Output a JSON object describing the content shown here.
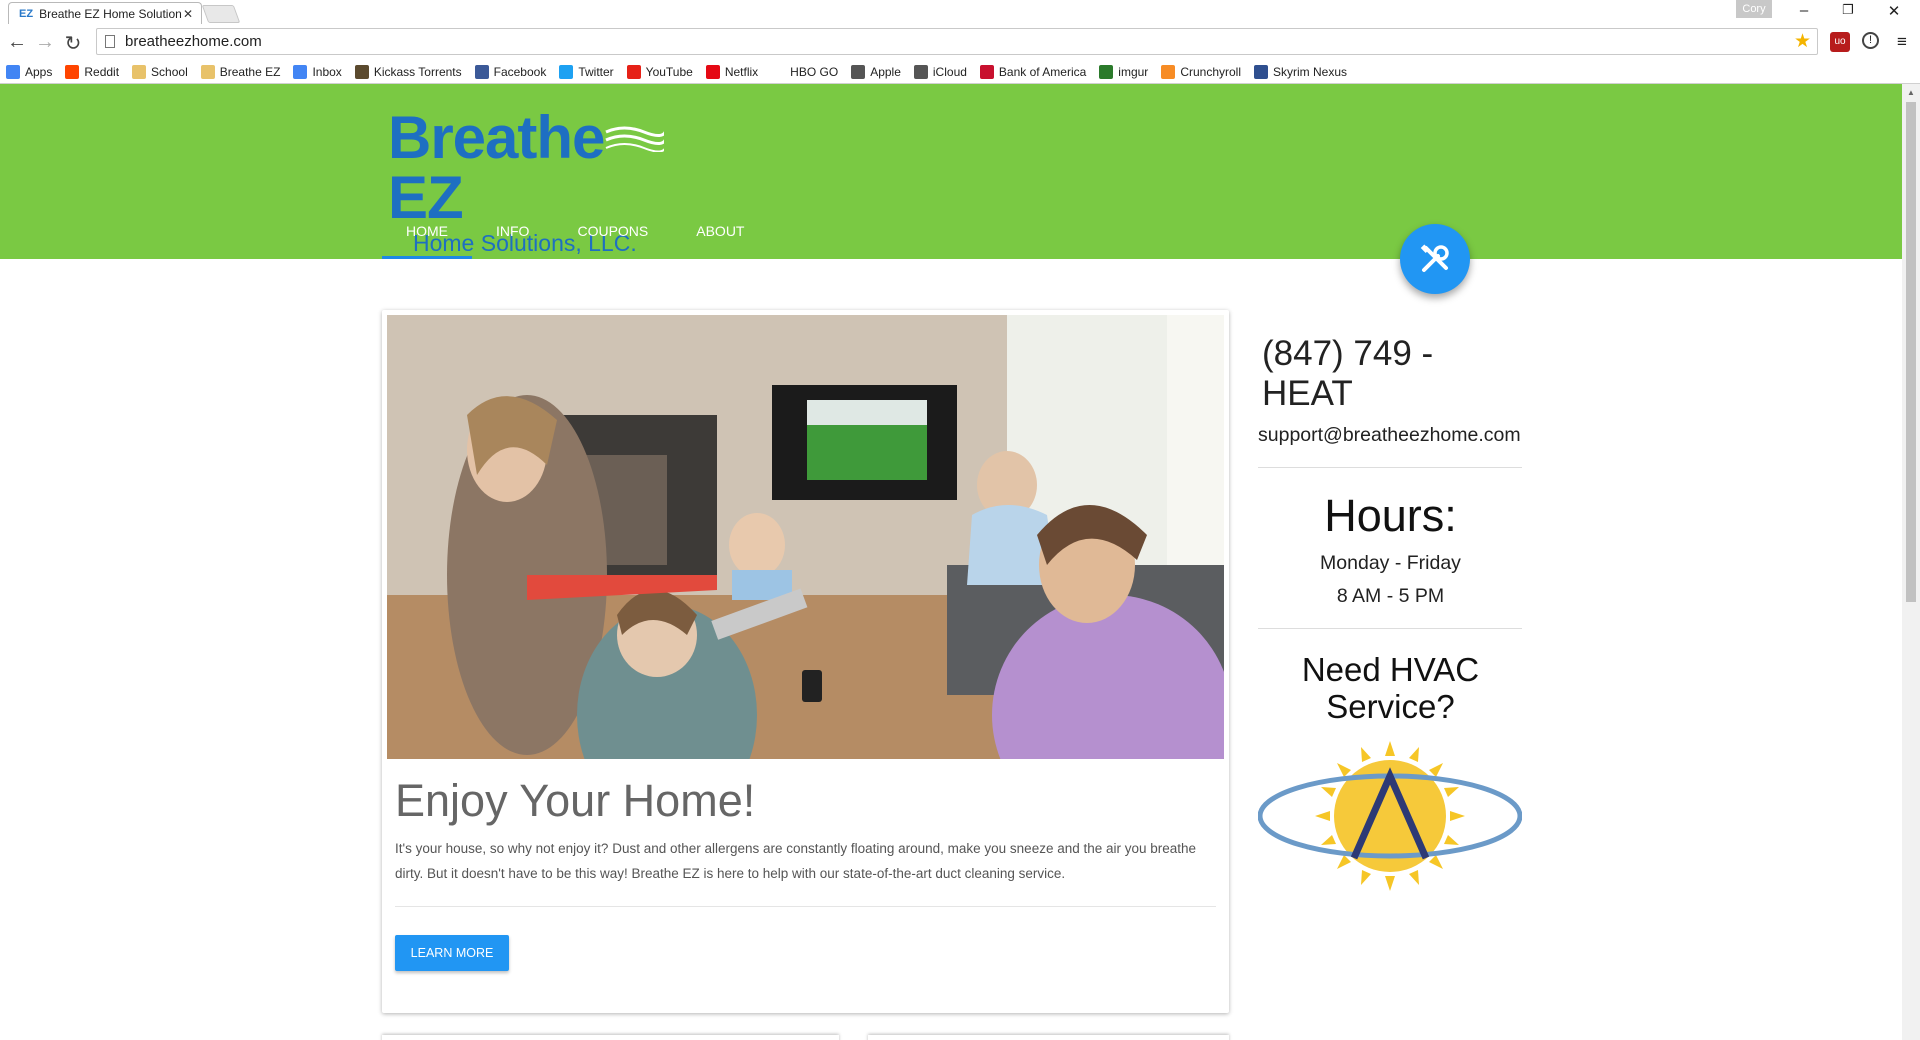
{
  "browser": {
    "tab_title": "Breathe EZ Home Solution",
    "tab_favicon": "EZ",
    "profile_name": "Cory",
    "url": "breatheezhome.com",
    "bookmarks": [
      {
        "label": "Apps",
        "icon": "apps-grid-icon",
        "color": "#4285f4"
      },
      {
        "label": "Reddit",
        "icon": "reddit-icon",
        "color": "#ff4500"
      },
      {
        "label": "School",
        "icon": "folder-icon",
        "color": "#e8c26a"
      },
      {
        "label": "Breathe EZ",
        "icon": "folder-icon",
        "color": "#e8c26a"
      },
      {
        "label": "Inbox",
        "icon": "inbox-icon",
        "color": "#4285f4"
      },
      {
        "label": "Kickass Torrents",
        "icon": "kickass-icon",
        "color": "#5b4a2e"
      },
      {
        "label": "Facebook",
        "icon": "facebook-icon",
        "color": "#3b5998"
      },
      {
        "label": "Twitter",
        "icon": "twitter-icon",
        "color": "#1da1f2"
      },
      {
        "label": "YouTube",
        "icon": "youtube-icon",
        "color": "#e62117"
      },
      {
        "label": "Netflix",
        "icon": "netflix-icon",
        "color": "#e50914"
      },
      {
        "label": "HBO GO",
        "icon": "blank-icon",
        "color": "#ffffff"
      },
      {
        "label": "Apple",
        "icon": "apple-icon",
        "color": "#555555"
      },
      {
        "label": "iCloud",
        "icon": "apple-icon",
        "color": "#555555"
      },
      {
        "label": "Bank of America",
        "icon": "bofa-icon",
        "color": "#c8102e"
      },
      {
        "label": "imgur",
        "icon": "imgur-icon",
        "color": "#2b7a2b"
      },
      {
        "label": "Crunchyroll",
        "icon": "crunchyroll-icon",
        "color": "#f78c25"
      },
      {
        "label": "Skyrim Nexus",
        "icon": "nexus-icon",
        "color": "#2f4f8f"
      }
    ]
  },
  "site": {
    "logo_main": "Breathe",
    "logo_ez": "EZ",
    "logo_sub": "Home Solutions, LLC.",
    "nav": [
      "HOME",
      "INFO",
      "COUPONS",
      "ABOUT"
    ],
    "header_color": "#7ac943",
    "accent_color": "#2196f3"
  },
  "hero": {
    "title": "Enjoy Your Home!",
    "body": "It's your house, so why not enjoy it? Dust and other allergens are constantly floating around, make you sneeze and the air you breathe dirty. But it doesn't have to be this way! Breathe EZ is here to help with our state-of-the-art duct cleaning service.",
    "button": "LEARN MORE"
  },
  "sidebar": {
    "phone": "(847) 749 - HEAT",
    "email": "support@breatheezhome.com",
    "hours_title": "Hours:",
    "hours_days": "Monday - Friday",
    "hours_time": "8 AM - 5 PM",
    "hvac_line1": "Need HVAC",
    "hvac_line2": "Service?"
  }
}
